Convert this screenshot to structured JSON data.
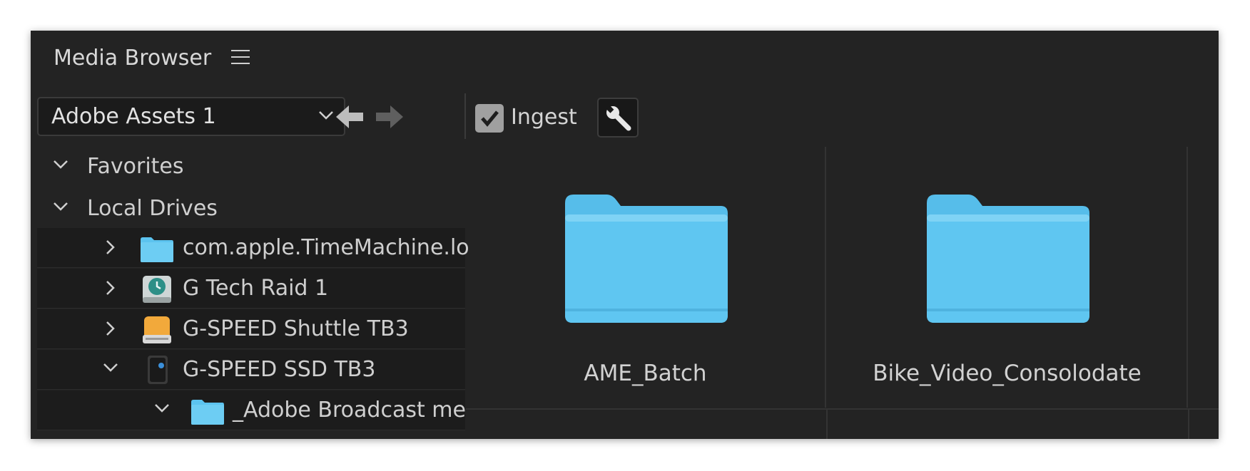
{
  "panel": {
    "title": "Media Browser"
  },
  "location": {
    "selected": "Adobe Assets 1"
  },
  "toolbar": {
    "ingest_label": "Ingest",
    "ingest_checked": true
  },
  "tree": {
    "favorites": "Favorites",
    "local_drives": "Local Drives",
    "items": [
      {
        "label": "com.apple.TimeMachine.lo",
        "icon": "folder-icon",
        "expanded": false
      },
      {
        "label": "G Tech Raid 1",
        "icon": "time-machine-drive-icon",
        "expanded": false
      },
      {
        "label": "G-SPEED Shuttle TB3",
        "icon": "external-drive-icon",
        "expanded": false
      },
      {
        "label": "G-SPEED SSD TB3",
        "icon": "ssd-drive-icon",
        "expanded": true
      },
      {
        "label": "_Adobe Broadcast me",
        "icon": "folder-icon",
        "expanded": true
      }
    ]
  },
  "content": {
    "folders": [
      {
        "name": "AME_Batch"
      },
      {
        "name": "Bike_Video_Consolodate"
      }
    ]
  },
  "colors": {
    "panel_bg": "#232323",
    "folder": "#5cc3ef",
    "checkbox": "#a0a0a0"
  }
}
